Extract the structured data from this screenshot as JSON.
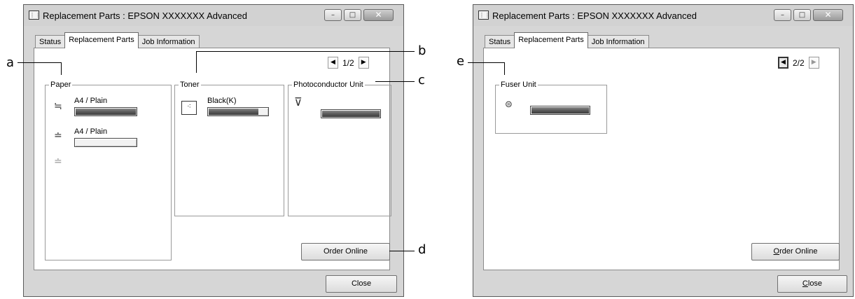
{
  "left_window": {
    "title": "Replacement Parts : EPSON XXXXXXX  Advanced",
    "tabs": [
      "Status",
      "Replacement Parts",
      "Job Information"
    ],
    "pager": {
      "text": "1/2",
      "prev": "◀",
      "next": "▶"
    },
    "paper": {
      "label": "Paper",
      "trays": [
        {
          "label": "A4 / Plain",
          "level": 1.0
        },
        {
          "label": "A4 / Plain",
          "level": 0.0
        },
        {
          "label": ""
        }
      ]
    },
    "toner": {
      "label": "Toner",
      "color": "Black(K)",
      "level": 0.85
    },
    "photoconductor": {
      "label": "Photoconductor Unit",
      "level": 1.0
    },
    "order_online": "Order Online",
    "close": "Close"
  },
  "right_window": {
    "title": "Replacement Parts : EPSON XXXXXXX  Advanced",
    "tabs": [
      "Status",
      "Replacement Parts",
      "Job Information"
    ],
    "pager": {
      "text": "2/2",
      "prev": "◀",
      "next": "▶"
    },
    "fuser": {
      "label": "Fuser Unit",
      "level": 1.0
    },
    "order_online_underline": "O",
    "order_online_rest": "rder Online",
    "close_underline": "C",
    "close_rest": "lose"
  },
  "callouts": [
    "a",
    "b",
    "c",
    "d",
    "e"
  ],
  "titlebar_buttons": {
    "minimize": "–",
    "maximize": "□",
    "close": "✕"
  },
  "icons": {
    "app": "printer-icon",
    "paper_tray": "tray-icon",
    "toner": "toner-icon",
    "photoconductor": "drum-icon",
    "fuser": "fuser-icon"
  }
}
